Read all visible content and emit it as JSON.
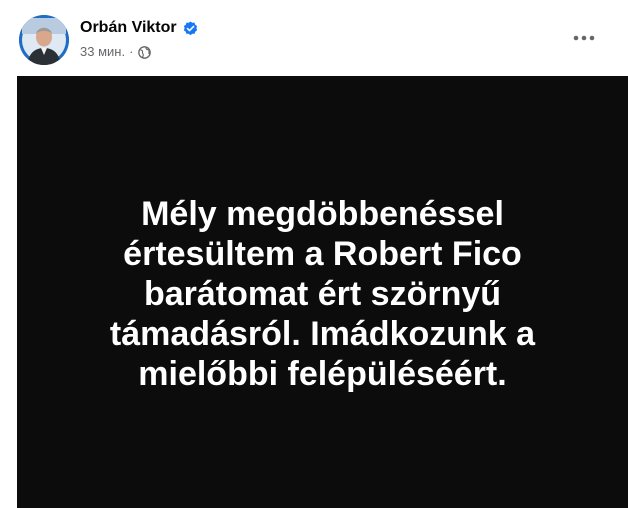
{
  "post": {
    "author": "Orbán Viktor",
    "timestamp": "33 мин.",
    "separator": "·",
    "icons": {
      "verified": "verified-badge-icon",
      "audience": "globe-icon",
      "more": "more-options-icon"
    },
    "colors": {
      "verified": "#1877f2",
      "image_background": "#0c0c0c",
      "image_text": "#ffffff"
    },
    "image_text_lines": [
      "Mély megdöbbenéssel",
      "értesültem a Robert Fico",
      "barátomat ért szörnyű",
      "támadásról. Imádkozunk a",
      "mielőbbi felépüléséért."
    ]
  }
}
